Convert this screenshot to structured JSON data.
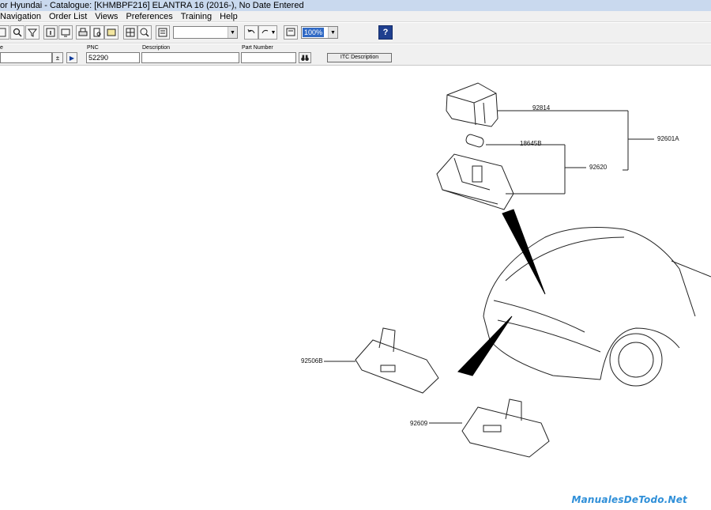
{
  "window": {
    "title": "or Hyundai - Catalogue: [KHMBPF216] ELANTRA 16 (2016-), No Date Entered"
  },
  "menu": [
    "Navigation",
    "Order List",
    "Views",
    "Preferences",
    "Training",
    "Help"
  ],
  "toolbar": {
    "zoom_value": "100%",
    "dropdown_value": ""
  },
  "search": {
    "first_label": "e",
    "pnc_label": "PNC",
    "pnc_value": "52290",
    "description_label": "Description",
    "description_value": "",
    "part_number_label": "Part Number",
    "part_number_value": "",
    "itc_button": "ITC Description"
  },
  "diagram": {
    "labels": {
      "p92814": "92814",
      "p18645b": "18645B",
      "p92620": "92620",
      "p92601a": "92601A",
      "p92506b": "92506B",
      "p92609": "92609"
    }
  },
  "watermark": "ManualesDeTodo.Net"
}
